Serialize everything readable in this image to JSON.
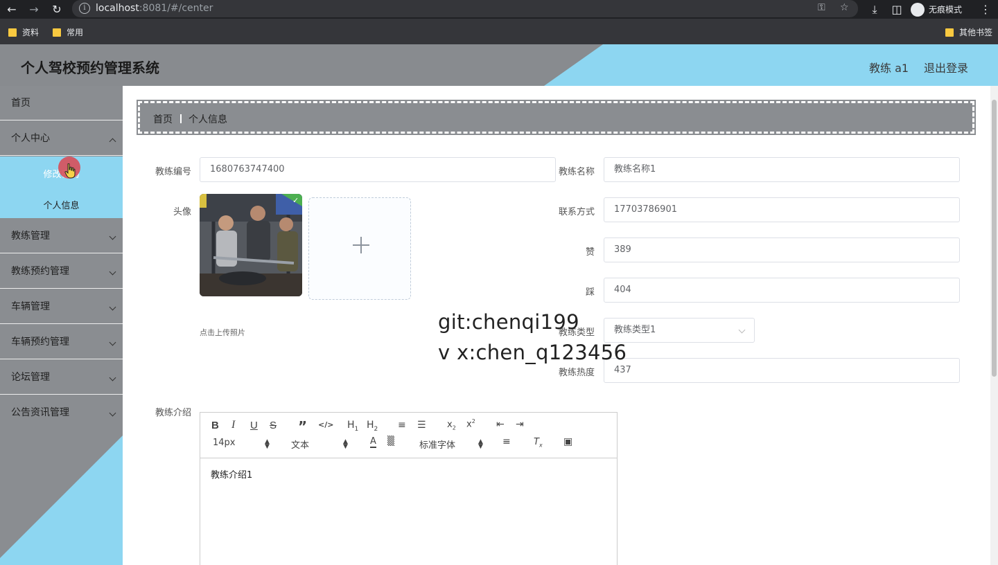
{
  "browser": {
    "url_host": "localhost",
    "url_rest": ":8081/#/center",
    "incognito_label": "无痕模式",
    "bookmarks": [
      "资料",
      "常用"
    ],
    "other_bookmarks": "其他书签"
  },
  "header": {
    "title": "个人驾校预约管理系统",
    "user": "教练 a1",
    "logout": "退出登录"
  },
  "sidebar": {
    "items": [
      "首页",
      "个人中心",
      "教练管理",
      "教练预约管理",
      "车辆管理",
      "车辆预约管理",
      "论坛管理",
      "公告资讯管理"
    ],
    "submenu": [
      "修改密码",
      "个人信息"
    ]
  },
  "breadcrumb": [
    "首页",
    "个人信息"
  ],
  "form": {
    "coach_no_label": "教练编号",
    "coach_no": "1680763747400",
    "coach_name_label": "教练名称",
    "coach_name": "教练名称1",
    "avatar_label": "头像",
    "upload_hint": "点击上传照片",
    "contact_label": "联系方式",
    "contact": "17703786901",
    "like_label": "赞",
    "like": "389",
    "dislike_label": "踩",
    "dislike": "404",
    "type_label": "教练类型",
    "type": "教练类型1",
    "heat_label": "教练热度",
    "heat": "437",
    "intro_label": "教练介绍",
    "intro": "教练介绍1"
  },
  "editor": {
    "font_size": "14px",
    "text_style": "文本",
    "font_family": "标准字体",
    "h1": "H",
    "h2": "H"
  },
  "watermark": {
    "line1": "git:chenqi199",
    "line2": "v x:chen_q123456"
  },
  "colors": {
    "header_gray": "#888b8f",
    "accent_blue": "#8dd6f1"
  }
}
